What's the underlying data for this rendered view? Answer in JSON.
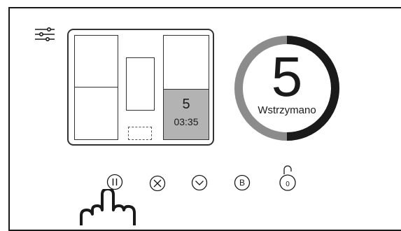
{
  "zone": {
    "number": "5",
    "time": "03:35"
  },
  "program": {
    "number": "5",
    "status": "Wstrzymano",
    "progress": 0.5
  },
  "controls": {
    "pause_icon": "pause-icon",
    "stop_icon": "close-circle-icon",
    "chevron_icon": "chevron-down-icon",
    "boost_label": "B",
    "lock_label": "0"
  },
  "colors": {
    "active_zone": "#b3b3b3",
    "ring_progress": "#1a1a1a",
    "ring_track": "#8c8c8c"
  }
}
